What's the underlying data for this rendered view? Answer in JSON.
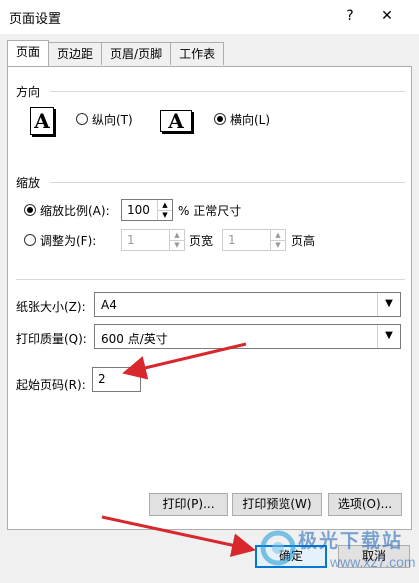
{
  "window": {
    "title": "页面设置",
    "help": "?",
    "close": "✕"
  },
  "tabs": [
    "页面",
    "页边距",
    "页眉/页脚",
    "工作表"
  ],
  "orientation": {
    "section": "方向",
    "portrait_icon": "A",
    "landscape_icon": "A",
    "portrait_label": "纵向(T)",
    "landscape_label": "横向(L)",
    "selected": "landscape"
  },
  "scaling": {
    "section": "缩放",
    "adjust_to_label": "缩放比例(A):",
    "adjust_to_value": "100",
    "adjust_to_suffix": "% 正常尺寸",
    "fit_to_label": "调整为(F):",
    "fit_wide_value": "1",
    "fit_wide_suffix": "页宽",
    "fit_tall_value": "1",
    "fit_tall_suffix": "页高",
    "selected": "adjust_to"
  },
  "paper": {
    "size_label": "纸张大小(Z):",
    "size_value": "A4",
    "quality_label": "打印质量(Q):",
    "quality_value": "600 点/英寸",
    "first_page_label": "起始页码(R):",
    "first_page_value": "2"
  },
  "buttons": {
    "print": "打印(P)...",
    "preview": "打印预览(W)",
    "options": "选项(O)...",
    "ok": "确定",
    "cancel": "取消"
  },
  "watermark": {
    "name": "极光下载站",
    "url": "www.xz7.com"
  },
  "colors": {
    "accent": "#0078d7",
    "annotation_arrow": "#d9272e"
  }
}
